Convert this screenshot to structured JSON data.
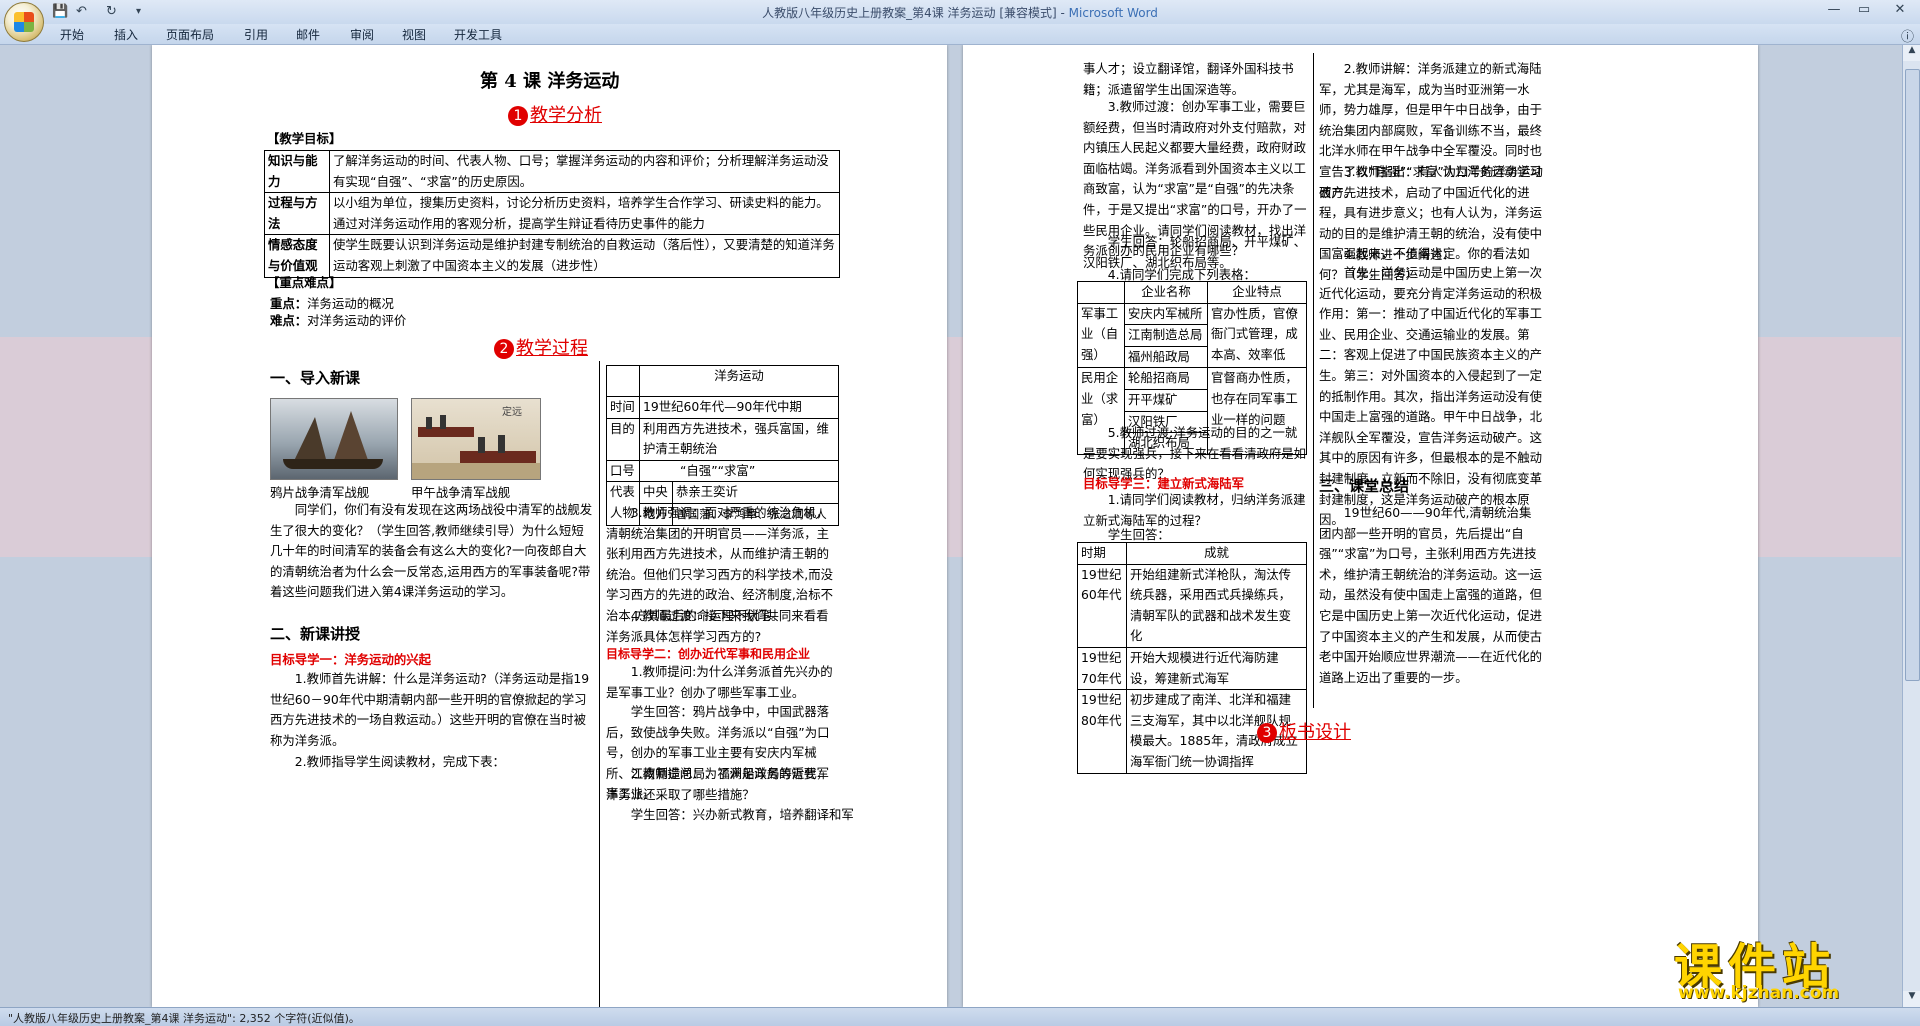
{
  "window": {
    "title": "人教版八年级历史上册教案_第4课 洋务运动 [兼容模式] - ",
    "app": "Microsoft Word"
  },
  "ribbon": {
    "tabs": [
      "开始",
      "插入",
      "页面布局",
      "引用",
      "邮件",
      "审阅",
      "视图",
      "开发工具"
    ]
  },
  "status": {
    "text": "\"人教版八年级历史上册教案_第4课 洋务运动\": 2,352 个字符(近似值)。"
  },
  "watermark": {
    "text": "课件站",
    "url": "www.kjzhan.com"
  },
  "doc": {
    "title": "第 4 课    洋务运动",
    "sec1": {
      "num": "1",
      "label": "教学分析"
    },
    "objectives_heading": "【教学目标】",
    "objectives": [
      {
        "k": "知识与能力",
        "v": "了解洋务运动的时间、代表人物、口号；掌握洋务运动的内容和评价；分析理解洋务运动没有实现“自强”、“求富”的历史原因。"
      },
      {
        "k": "过程与方法",
        "v": "以小组为单位，搜集历史资料，讨论分析历史资料，培养学生合作学习、研读史料的能力。通过对洋务运动作用的客观分析，提高学生辩证看待历史事件的能力"
      },
      {
        "k": "情感态度与价值观",
        "v": "使学生既要认识到洋务运动是维护封建专制统治的自救运动（落后性），又要清楚的知道洋务运动客观上刺激了中国资本主义的发展（进步性）"
      }
    ],
    "keypoints_heading": "【重点难点】",
    "key": {
      "label": "重点：",
      "text": "洋务运动的概况"
    },
    "diff": {
      "label": "难点：",
      "text": "对洋务运动的评价"
    },
    "sec2": {
      "num": "2",
      "label": "教学过程"
    },
    "h_intro": "一、导入新课",
    "img1_caption": "鸦片战争清军战舰",
    "img2_caption": "甲午战争清军战舰",
    "img2_stamp": "定远",
    "intro_text": "同学们，你们有没有发现在这两场战役中清军的战舰发生了很大的变化？（学生回答,教师继续引导）为什么短短几十年的时间清军的装备会有这么大的变化?一向夜郎自大的清朝统治者为什么会一反常态,运用西方的军事装备呢?带着这些问题我们进入第4课洋务运动的学习。",
    "h_new": "二、新课讲授",
    "goal1": "目标导学一：洋务运动的兴起",
    "goal1_p1": "1.教师首先讲解：什么是洋务运动?（洋务运动是指19世纪60－90年代中期清朝内部一些开明的官僚掀起的学习西方先进技术的一场自救运动。）这些开明的官僚在当时被称为洋务派。",
    "goal1_p2": "2.教师指导学生阅读教材，完成下表：",
    "t1": {
      "header": "洋务运动",
      "time_k": "时间",
      "time_v": "19世纪60年代—90年代中期",
      "aim_k": "目的",
      "aim_v": "利用西方先进技术，强兵富国，维护清王朝统治",
      "slogan_k": "口号",
      "slogan_v": "“自强”“求富”",
      "rep_k": "代表人物",
      "central_k": "中央",
      "central_v": "恭亲王奕䜣",
      "local_k": "地方",
      "local_v": "曾国藩、李鸿章、张之洞等人"
    },
    "mid_p1": "3.教师强调：面对严重的统治危机，清朝统治集团的开明官员——洋务派，主张利用西方先进技术，从而维护清王朝的统治。但他们只学习西方的科学技术,而没学习西方的先进的政治、经济制度,治标不治本,方其最后的命运埋下伏笔。",
    "mid_p2": "4.教师过渡：接下来我们共同来看看洋务派具体怎样学习西方的?",
    "goal2": "目标导学二：创办近代军事和民用企业",
    "goal2_p1": "1.教师提问:为什么洋务派首先兴办的是军事工业？创办了哪些军事工业。",
    "goal2_p2": "学生回答：鸦片战争中，中国武器落后，致使战争失败。洋务派以“自强”为口号，创办的军事工业主要有安庆内军械所、江南制造总局、福州船政局等近代军事工业。",
    "goal2_p3": "2.教师提问：为了满足洋务的需要，洋务派还采取了哪些措施？",
    "goal2_p4": "学生回答：兴办新式教育，培养翻译和军",
    "r_p1": "事人才；设立翻译馆，翻译外国科技书籍；派遣留学生出国深造等。",
    "r_p2": "3.教师过渡：创办军事工业，需要巨额经费，但当时清政府对外支付赔款，对内镇压人民起义都要大量经费，政府财政面临枯竭。洋务派看到外国资本主义以工商致富，认为“求富”是“自强”的先决条件，于是又提出“求富”的口号，开办了一些民用企业。请同学们阅读教材，找出洋务派创办的民用企业有哪些？",
    "r_p3": "学生回答：轮船招商局、开平煤矿、汉阳铁厂、湖北织布局等。",
    "r_p4": "4.请同学们完成下列表格：",
    "t2": {
      "h1": "企业名称",
      "h2": "企业特点",
      "mil_k": "军事工业（自强）",
      "mil": [
        "安庆内军械所",
        "江南制造总局",
        "福州船政局"
      ],
      "mil_v": "官办性质，官僚衙门式管理，成本高、效率低",
      "civ_k": "民用企业（求富）",
      "civ": [
        "轮船招商局",
        "开平煤矿",
        "汉阳铁厂",
        "湖北织布局"
      ],
      "civ_v": "官督商办性质，也存在同军事工业一样的问题"
    },
    "r_p5": "5.教师过渡:洋务运动的目的之一就是要实现强兵，接下来在看看清政府是如何实现强兵的？",
    "goal3": "目标导学三：建立新式海陆军",
    "goal3_p1": "1.请同学们阅读教材，归纳洋务派建立新式海陆军的过程？",
    "goal3_p2": "学生回答：",
    "t3": {
      "h1": "时期",
      "h2": "成就",
      "rows": [
        {
          "k": "19世纪60年代",
          "v": "开始组建新式洋枪队，淘汰传统兵器，采用西式兵操练兵，清朝军队的武器和战术发生变化"
        },
        {
          "k": "19世纪70年代",
          "v": "开始大规模进行近代海防建设，筹建新式海军"
        },
        {
          "k": "19世纪80年代",
          "v": "初步建成了南洋、北洋和福建三支海军，其中以北洋舰队规模最大。1885年，清政府成立海军衙门统一协调指挥"
        }
      ]
    },
    "r2_p1": "2.教师讲解：洋务派建立的新式海陆军，尤其是海军，成为当时亚洲第一水师，势力雄厚，但是甲午中日战争，由于统治集团内部腐败，军备训练不当，最终北洋水师在甲午战争中全军覆没。同时也宣告了以“自强”“求富”为口号的洋务运动破产。",
    "r2_p2": "3.教师指出：有人认为洋务运动学习西方先进技术，启动了中国近代化的进程，具有进步意义；也有人认为，洋务运动的目的是维护清王朝的统治，没有使中国富强起来，不值得肯定。你的看法如何？（学生回答）",
    "r2_p3": "4.教师进一步阐述：",
    "r2_p4": "首先，洋务运动是中国历史上第一次近代化运动，要充分肯定洋务运动的积极作用：第一：推动了中国近代化的军事工业、民用企业、交通运输业的发展。第二：客观上促进了中国民族资本主义的产生。第三：对外国资本的入侵起到了一定的抵制作用。其次，指出洋务运动没有使中国走上富强的道路。甲午中日战争，北洋舰队全军覆没，宣告洋务运动破产。这其中的原因有许多，但最根本的是不触动封建制度，立新而不除旧，没有彻底变革封建制度，这是洋务运动破产的根本原因。",
    "h_summary": "三、课堂总结",
    "summary": "19世纪60——90年代,清朝统治集团内部一些开明的官员，先后提出“自强”“求富”为口号，主张利用西方先进技术，维护清王朝统治的洋务运动。这一运动，虽然没有使中国走上富强的道路，但它是中国历史上第一次近代化运动，促进了中国资本主义的产生和发展，从而使古老中国开始顺应世界潮流——在近代化的道路上迈出了重要的一步。",
    "sec3": {
      "num": "3",
      "label": "板书设计"
    }
  }
}
